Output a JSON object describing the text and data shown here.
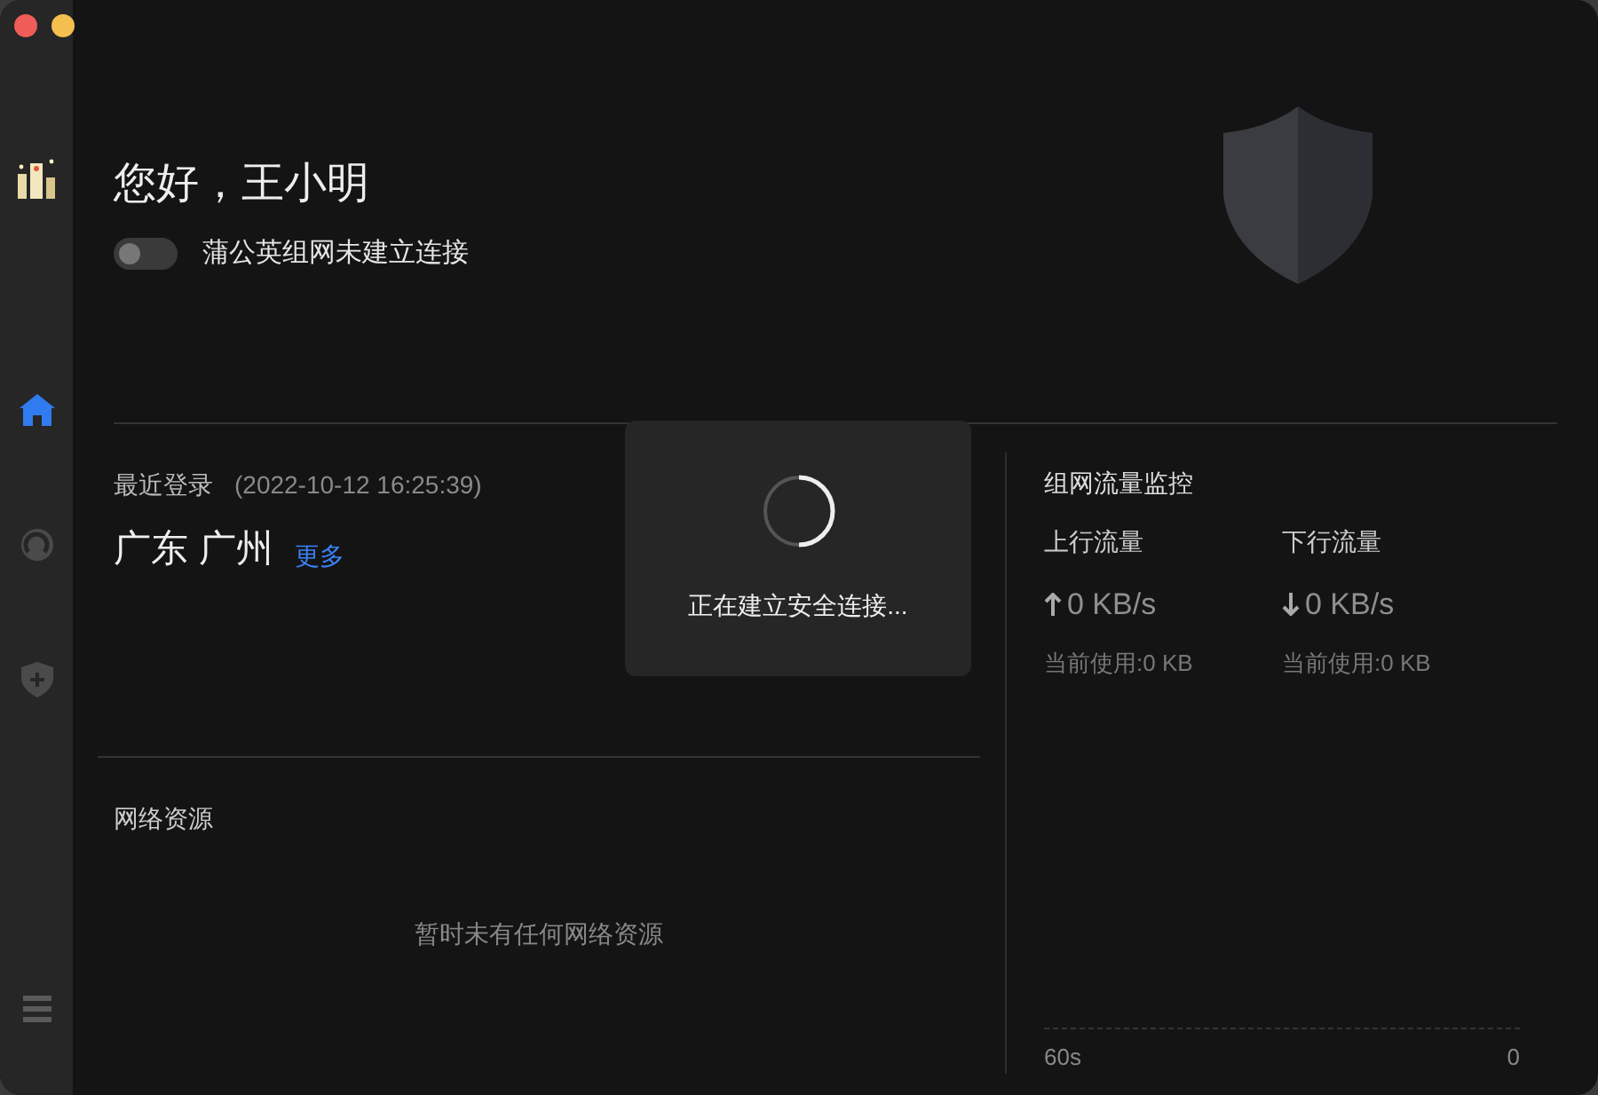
{
  "sidebar": {
    "items": [
      {
        "kind": "logo"
      },
      {
        "kind": "home",
        "selected": true
      },
      {
        "kind": "network",
        "selected": false
      },
      {
        "kind": "shield",
        "selected": false
      },
      {
        "kind": "menu"
      }
    ]
  },
  "greeting": "您好，王小明",
  "connection": {
    "on": false,
    "label": "蒲公英组网未建立连接"
  },
  "last_login": {
    "label": "最近登录",
    "time": "(2022-10-12 16:25:39)",
    "location": "广东 广州",
    "more_link": "更多"
  },
  "resources": {
    "title": "网络资源",
    "empty_text": "暂时未有任何网络资源"
  },
  "traffic": {
    "title": "组网流量监控",
    "columns": [
      {
        "kind": "up",
        "label": "上行流量",
        "rate": "0 KB/s",
        "usage": "当前使用:0 KB"
      },
      {
        "kind": "down",
        "label": "下行流量",
        "rate": "0 KB/s",
        "usage": "当前使用:0 KB"
      }
    ],
    "axis_start": "60s",
    "axis_end": "0"
  },
  "loading_dialog": {
    "message": "正在建立安全连接..."
  }
}
